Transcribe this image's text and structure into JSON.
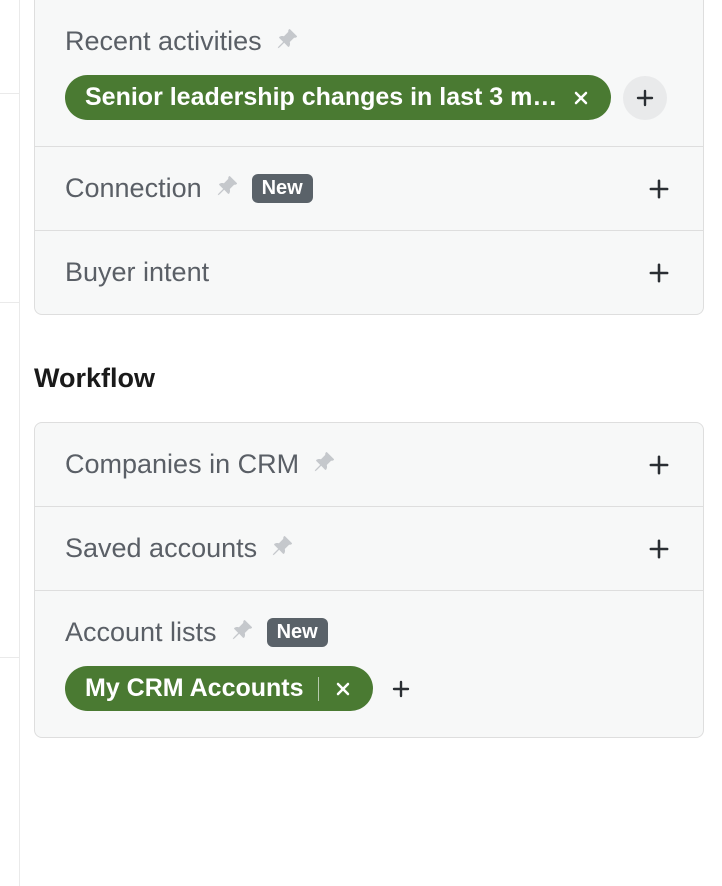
{
  "filter_groups": [
    {
      "id": "recent-activities",
      "title": "Recent activities",
      "pinned": true,
      "has_new_badge": false,
      "expand_plus": false,
      "chips": [
        {
          "label": "Senior leadership changes in last 3 m…",
          "has_divider": false
        }
      ],
      "chip_add_style": "circle"
    },
    {
      "id": "connection",
      "title": "Connection",
      "pinned": true,
      "has_new_badge": true,
      "new_label": "New",
      "expand_plus": true,
      "chips": []
    },
    {
      "id": "buyer-intent",
      "title": "Buyer intent",
      "pinned": false,
      "has_new_badge": false,
      "expand_plus": true,
      "chips": []
    }
  ],
  "section_heading": "Workflow",
  "workflow_groups": [
    {
      "id": "companies-in-crm",
      "title": "Companies in CRM",
      "pinned": true,
      "has_new_badge": false,
      "expand_plus": true,
      "chips": []
    },
    {
      "id": "saved-accounts",
      "title": "Saved accounts",
      "pinned": true,
      "has_new_badge": false,
      "expand_plus": true,
      "chips": []
    },
    {
      "id": "account-lists",
      "title": "Account lists",
      "pinned": true,
      "has_new_badge": true,
      "new_label": "New",
      "expand_plus": false,
      "chips": [
        {
          "label": "My CRM Accounts",
          "has_divider": true
        }
      ],
      "chip_add_style": "bare"
    }
  ]
}
